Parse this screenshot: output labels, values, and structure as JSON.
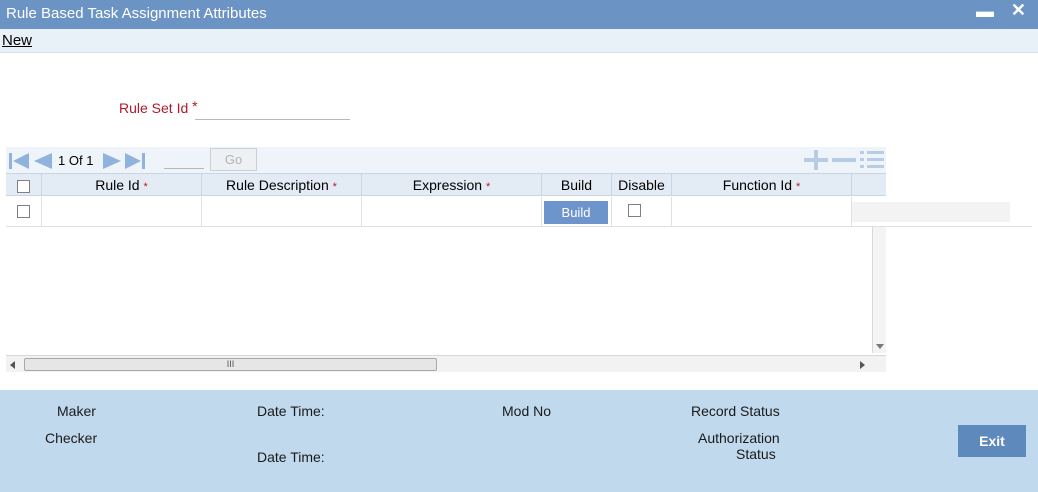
{
  "window": {
    "title": "Rule Based Task Assignment Attributes",
    "minimize_glyph": "▬",
    "close_glyph": "✕"
  },
  "menu": {
    "new_label": "New"
  },
  "form": {
    "rule_set_id_label": "Rule Set Id",
    "required_mark": "*",
    "rule_set_id_value": ""
  },
  "grid": {
    "pager": {
      "current": "1",
      "of_label": "Of",
      "total": "1"
    },
    "go_label": "Go",
    "columns": [
      {
        "label": "Rule Id",
        "required": "*"
      },
      {
        "label": "Rule Description",
        "required": "*"
      },
      {
        "label": "Expression",
        "required": "*"
      },
      {
        "label": "Build",
        "required": ""
      },
      {
        "label": "Disable",
        "required": ""
      },
      {
        "label": "Function Id",
        "required": "*"
      }
    ],
    "row_build_label": "Build",
    "hscroll_grip": "III"
  },
  "footer": {
    "maker_label": "Maker",
    "checker_label": "Checker",
    "date_time_label": "Date Time:",
    "date_time_label_2": "Date Time:",
    "mod_no_label": "Mod No",
    "record_status_label": "Record Status",
    "authorization_label": "Authorization",
    "status_label": "Status",
    "exit_label": "Exit"
  },
  "colors": {
    "titlebar": "#6b93c4",
    "required_red": "#b0192b",
    "footer_bg": "#c1d9ed",
    "exit_btn": "#5d89bc",
    "build_btn": "#6e94cc"
  }
}
